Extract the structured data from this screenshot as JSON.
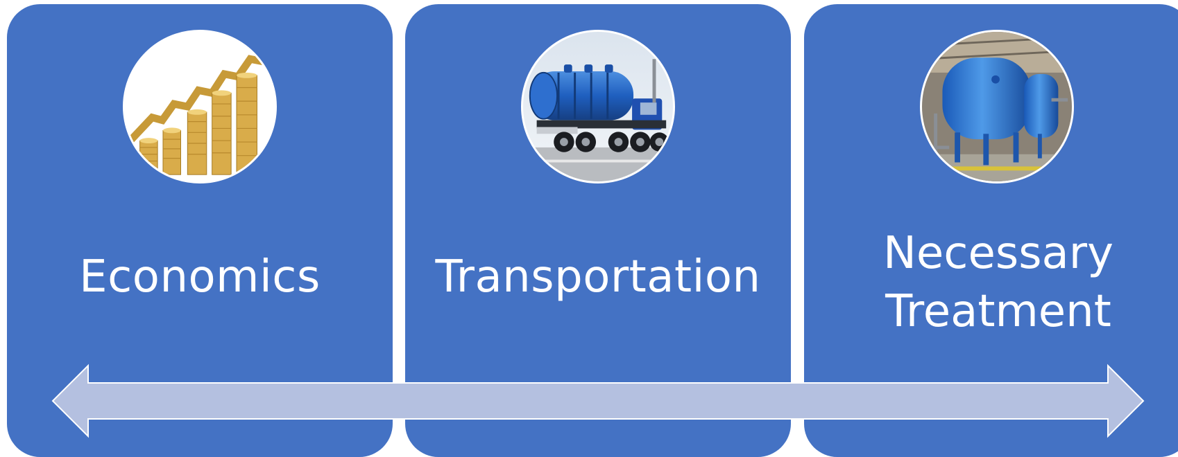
{
  "panels": [
    {
      "label": "Economics",
      "photo": "rising-coin-stacks-photo"
    },
    {
      "label": "Transportation",
      "photo": "vacuum-tanker-truck-photo"
    },
    {
      "label_lines": [
        "Necessary",
        "Treatment"
      ],
      "photo": "blue-filtration-tanks-photo"
    }
  ],
  "colors": {
    "panel": "#4472c4",
    "arrow_fill": "#b4c0e0",
    "arrow_stroke": "#ffffff",
    "text": "#ffffff"
  },
  "arrow": {
    "type": "double-headed",
    "icon": "double-arrow-icon"
  }
}
